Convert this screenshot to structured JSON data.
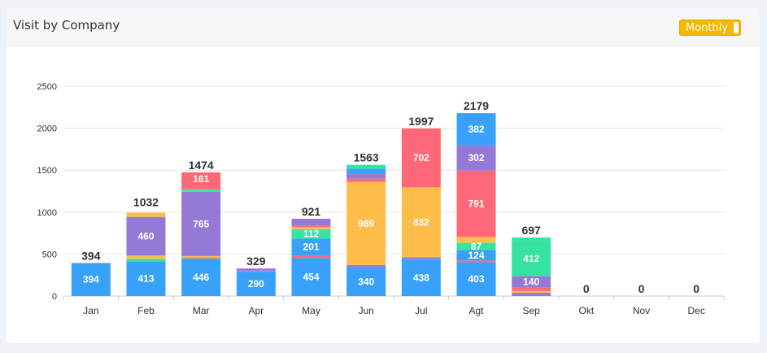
{
  "header": {
    "title": "Visit by Company",
    "period_label": "Monthly"
  },
  "colors": {
    "blue": "#38a2fb",
    "purple": "#9579d6",
    "yellow": "#ffbd4a",
    "pink": "#ff6878",
    "green": "#36e3a0",
    "lightpurple": "#b08be8",
    "orange": "#ffa04a",
    "accent": "#f5b800"
  },
  "chart_data": {
    "type": "bar",
    "stacked": true,
    "categories": [
      "Jan",
      "Feb",
      "Mar",
      "Apr",
      "May",
      "Jun",
      "Jul",
      "Agt",
      "Sep",
      "Okt",
      "Nov",
      "Dec"
    ],
    "ylim": [
      0,
      2500
    ],
    "yticks": [
      0,
      500,
      1000,
      1500,
      2000,
      2500
    ],
    "grid": true,
    "legend": "none",
    "totals": [
      394,
      1032,
      1474,
      329,
      921,
      1563,
      1997,
      2179,
      697,
      0,
      0,
      0
    ],
    "segments": [
      [
        {
          "value": 394,
          "color": "blue",
          "label": "394"
        }
      ],
      [
        {
          "value": 413,
          "color": "blue",
          "label": "413"
        },
        {
          "value": 30,
          "color": "green"
        },
        {
          "value": 40,
          "color": "yellow"
        },
        {
          "value": 460,
          "color": "purple",
          "label": "460"
        },
        {
          "value": 50,
          "color": "yellow"
        }
      ],
      [
        {
          "value": 446,
          "color": "blue",
          "label": "446"
        },
        {
          "value": 20,
          "color": "orange"
        },
        {
          "value": 10,
          "color": "yellow"
        },
        {
          "value": 765,
          "color": "purple",
          "label": "765"
        },
        {
          "value": 30,
          "color": "green"
        },
        {
          "value": 42,
          "color": "pink"
        },
        {
          "value": 161,
          "color": "pink",
          "label": "161"
        }
      ],
      [
        {
          "value": 290,
          "color": "blue",
          "label": "290"
        },
        {
          "value": 15,
          "color": "lightpurple"
        },
        {
          "value": 24,
          "color": "purple"
        }
      ],
      [
        {
          "value": 454,
          "color": "blue",
          "label": "454"
        },
        {
          "value": 30,
          "color": "pink"
        },
        {
          "value": 201,
          "color": "blue",
          "label": "201"
        },
        {
          "value": 112,
          "color": "green",
          "label": "112"
        },
        {
          "value": 24,
          "color": "yellow"
        },
        {
          "value": 20,
          "color": "pink"
        },
        {
          "value": 80,
          "color": "purple"
        }
      ],
      [
        {
          "value": 340,
          "color": "blue",
          "label": "340"
        },
        {
          "value": 30,
          "color": "purple"
        },
        {
          "value": 989,
          "color": "yellow",
          "label": "989"
        },
        {
          "value": 40,
          "color": "pink"
        },
        {
          "value": 60,
          "color": "purple"
        },
        {
          "value": 60,
          "color": "blue"
        },
        {
          "value": 44,
          "color": "green"
        }
      ],
      [
        {
          "value": 438,
          "color": "blue",
          "label": "438"
        },
        {
          "value": 25,
          "color": "purple"
        },
        {
          "value": 832,
          "color": "yellow",
          "label": "832"
        },
        {
          "value": 702,
          "color": "pink",
          "label": "702"
        }
      ],
      [
        {
          "value": 403,
          "color": "blue",
          "label": "403"
        },
        {
          "value": 20,
          "color": "pink"
        },
        {
          "value": 124,
          "color": "blue",
          "label": "124"
        },
        {
          "value": 87,
          "color": "green",
          "label": "87"
        },
        {
          "value": 70,
          "color": "yellow"
        },
        {
          "value": 791,
          "color": "pink",
          "label": "791"
        },
        {
          "value": 302,
          "color": "purple",
          "label": "302"
        },
        {
          "value": 382,
          "color": "blue",
          "label": "382"
        }
      ],
      [
        {
          "value": 40,
          "color": "purple"
        },
        {
          "value": 20,
          "color": "yellow"
        },
        {
          "value": 40,
          "color": "pink"
        },
        {
          "value": 140,
          "color": "purple",
          "label": "140"
        },
        {
          "value": 412,
          "color": "green",
          "label": "412"
        },
        {
          "value": 45,
          "color": "green"
        }
      ],
      [],
      [],
      []
    ]
  }
}
